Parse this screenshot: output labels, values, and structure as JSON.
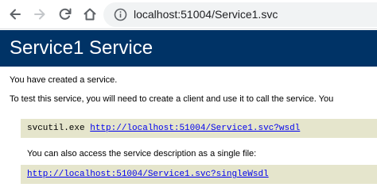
{
  "browser": {
    "icons": {
      "back": "arrow-left-icon",
      "forward": "arrow-right-icon",
      "reload": "reload-icon",
      "home": "home-icon",
      "site_info": "info-icon"
    },
    "address": "localhost:51004/Service1.svc"
  },
  "page": {
    "title": "Service1 Service",
    "intro": "You have created a service.",
    "instruction": "To test this service, you will need to create a client and use it to call the service. You",
    "svcutil_cmd": "svcutil.exe",
    "wsdl_link": "http://localhost:51004/Service1.svc?wsdl",
    "single_file_text": "You can also access the service description as a single file:",
    "single_wsdl_link": "http://localhost:51004/Service1.svc?singleWsdl"
  },
  "colors": {
    "header_bg": "#003366",
    "code_bg": "#e5e5cc",
    "link": "#0000ee"
  }
}
